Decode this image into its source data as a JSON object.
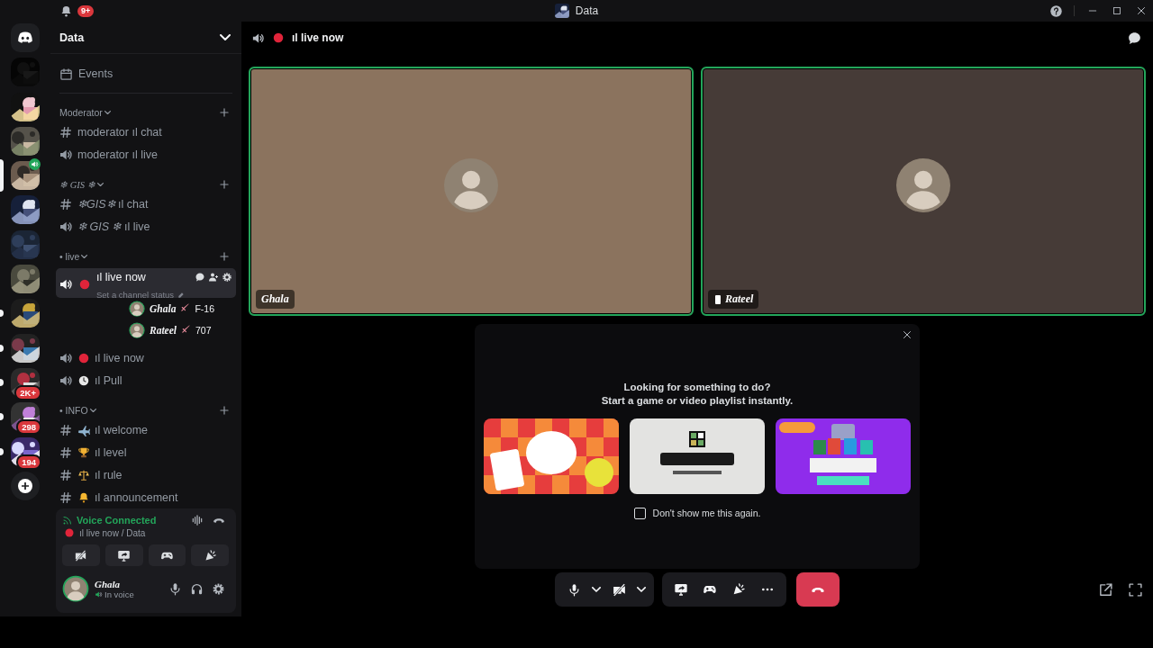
{
  "title_bar": {
    "notification_badge": "9+",
    "title": "Data"
  },
  "servers": [
    {
      "kind": "home",
      "selected": false,
      "unread": false,
      "in_voice": false
    },
    {
      "kind": "server",
      "selected": false,
      "unread": false,
      "in_voice": false
    },
    {
      "kind": "server",
      "selected": false,
      "unread": false,
      "in_voice": false
    },
    {
      "kind": "server",
      "selected": false,
      "unread": false,
      "in_voice": false
    },
    {
      "kind": "server",
      "selected": true,
      "unread": false,
      "in_voice": true
    },
    {
      "kind": "server",
      "selected": false,
      "unread": false,
      "in_voice": false
    },
    {
      "kind": "server",
      "selected": false,
      "unread": false,
      "in_voice": false
    },
    {
      "kind": "server",
      "selected": false,
      "unread": false,
      "in_voice": false
    },
    {
      "kind": "server",
      "selected": false,
      "unread": true,
      "in_voice": false
    },
    {
      "kind": "server",
      "selected": false,
      "unread": true,
      "in_voice": false
    },
    {
      "kind": "server",
      "selected": false,
      "unread": true,
      "in_voice": false,
      "badge": "2K+"
    },
    {
      "kind": "server",
      "selected": false,
      "unread": true,
      "in_voice": false,
      "badge": "298"
    },
    {
      "kind": "server",
      "selected": false,
      "unread": true,
      "in_voice": false,
      "badge": "194"
    },
    {
      "kind": "add",
      "selected": false,
      "unread": false,
      "in_voice": false
    }
  ],
  "sidebar": {
    "server_name": "Data",
    "links": [
      {
        "label": "Events"
      }
    ],
    "categories": [
      {
        "name": "Moderator",
        "fancy": false,
        "channels": [
          {
            "kind": "text",
            "name": "moderator ıl chat",
            "selected": false
          },
          {
            "kind": "voice",
            "name": "moderator ıl live",
            "selected": false
          }
        ]
      },
      {
        "name": "❄ GIS ❄",
        "fancy": true,
        "channels": [
          {
            "kind": "text",
            "name": "*❄GIS❄* ıl chat",
            "selected": false
          },
          {
            "kind": "voice",
            "name": "*❄ GIS ❄* ıl live",
            "selected": false
          }
        ]
      },
      {
        "name": "• live",
        "fancy": false,
        "channels": [
          {
            "kind": "voice",
            "name": "ıl live now",
            "selected": true,
            "status": "Set a channel status",
            "members": [
              {
                "name": "Ghala",
                "tag": "F-16"
              },
              {
                "name": "Rateel",
                "tag": "707"
              }
            ]
          },
          {
            "kind": "voice",
            "name": "ıl live now",
            "selected": false
          },
          {
            "kind": "voice",
            "name": "ıl Pull",
            "selected": false
          }
        ]
      },
      {
        "name": "• INFO",
        "fancy": false,
        "channels": [
          {
            "kind": "text",
            "name": "ıl welcome",
            "selected": false
          },
          {
            "kind": "text",
            "name": "ıl level",
            "selected": false
          },
          {
            "kind": "text",
            "name": "ıl rule",
            "selected": false
          },
          {
            "kind": "text",
            "name": "ıl announcement",
            "selected": false
          }
        ]
      }
    ]
  },
  "voice_panel": {
    "status": "Voice Connected",
    "location": "ıl live now / Data"
  },
  "user": {
    "name": "Ghala",
    "status": "In voice"
  },
  "main": {
    "channel": {
      "name": "ıl live now"
    },
    "tiles": [
      {
        "name": "Ghala",
        "speaking": true,
        "mobile": false,
        "color": "#8b735e"
      },
      {
        "name": "Rateel",
        "speaking": true,
        "mobile": true,
        "color": "#463b37"
      }
    ],
    "activity_prompt": {
      "heading": "Looking for something to do?",
      "subheading": "Start a game or video playlist instantly.",
      "dont_show": {
        "label": "Don't show me this again.",
        "checked": false
      }
    }
  }
}
